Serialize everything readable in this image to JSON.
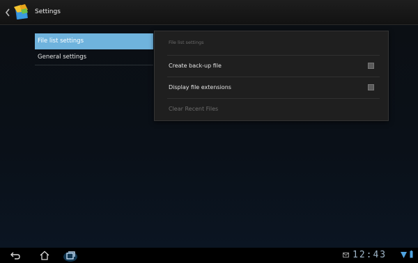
{
  "action_bar": {
    "title": "Settings",
    "icons": {
      "back": "chevron-left-icon",
      "app": "file-manager-app-icon"
    }
  },
  "nav": {
    "items": [
      {
        "label": "File list settings",
        "selected": true
      },
      {
        "label": "General settings",
        "selected": false
      }
    ]
  },
  "detail": {
    "header": "File list settings",
    "rows": [
      {
        "label": "Create back-up file",
        "type": "checkbox",
        "checked": false,
        "enabled": true
      },
      {
        "label": "Display file extensions",
        "type": "checkbox",
        "checked": false,
        "enabled": true
      },
      {
        "label": "Clear Recent Files",
        "type": "action",
        "enabled": false
      }
    ]
  },
  "system_bar": {
    "clock": "12:43",
    "icons": [
      "back-icon",
      "home-icon",
      "recent-apps-icon",
      "mail-icon",
      "wifi-signal-icon",
      "battery-icon"
    ]
  },
  "colors": {
    "selected_nav": "#6fb3dd",
    "pane_bg": "#1f1f1f",
    "clock": "#9fb6c9"
  }
}
